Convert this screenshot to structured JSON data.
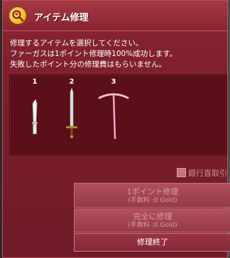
{
  "window": {
    "title": "アイテム修理"
  },
  "description": {
    "line1": "修理するアイテムを選択してください。",
    "line2": "ファーガスは1ポイント修理時100%成功します。",
    "line3": "失敗したポイント分の修理費はもらいません。"
  },
  "items": [
    {
      "number": "1",
      "icon": "knife-icon"
    },
    {
      "number": "2",
      "icon": "sword-icon"
    },
    {
      "number": "3",
      "icon": "pickaxe-icon"
    }
  ],
  "options": {
    "bank_direct_label": "銀行直取引"
  },
  "buttons": {
    "point_repair_label": "1ポイント修理",
    "point_repair_fee": "(手数料 :0 Gold)",
    "full_repair_label": "完全に修理",
    "full_repair_fee": "(手数料 :0 Gold)",
    "end_repair_label": "修理終了"
  },
  "colors": {
    "window_bg": "#7c1f2b",
    "panel_bg": "#5b0f18",
    "title_icon": "#f5b62b"
  }
}
